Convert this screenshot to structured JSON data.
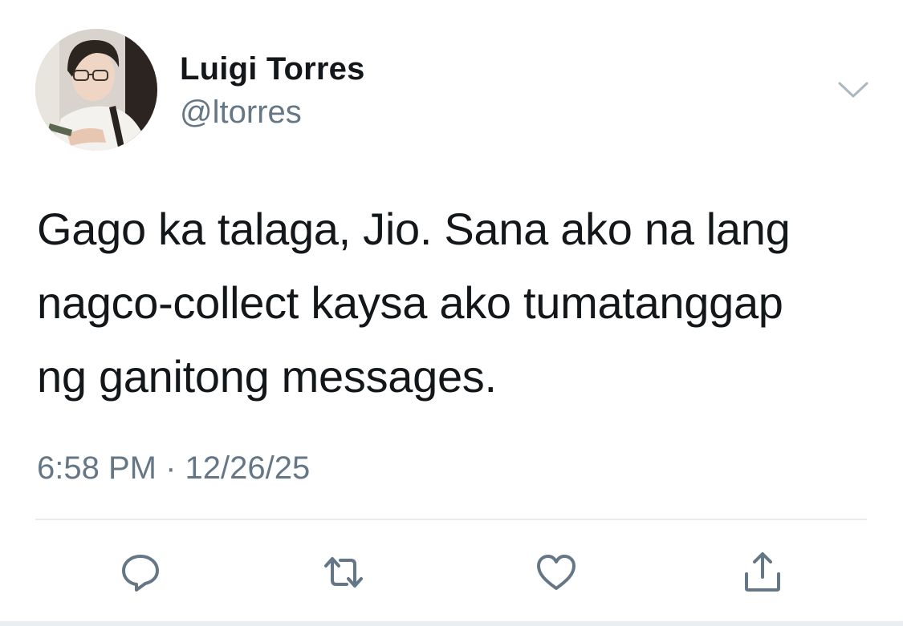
{
  "author": {
    "display_name": "Luigi Torres",
    "handle": "@ltorres"
  },
  "tweet": {
    "lines": [
      "Gago ka talaga, Jio. Sana ako na lang",
      "nagco-collect kaysa ako tumatanggap",
      "ng ganitong messages."
    ],
    "time": "6:58 PM",
    "separator": "·",
    "date": "12/26/25"
  },
  "actions": {
    "reply_icon": "reply-icon",
    "retweet_icon": "retweet-icon",
    "like_icon": "heart-icon",
    "share_icon": "share-icon"
  },
  "colors": {
    "text": "#14171a",
    "secondary": "#657786",
    "divider": "#e6ecf0"
  }
}
